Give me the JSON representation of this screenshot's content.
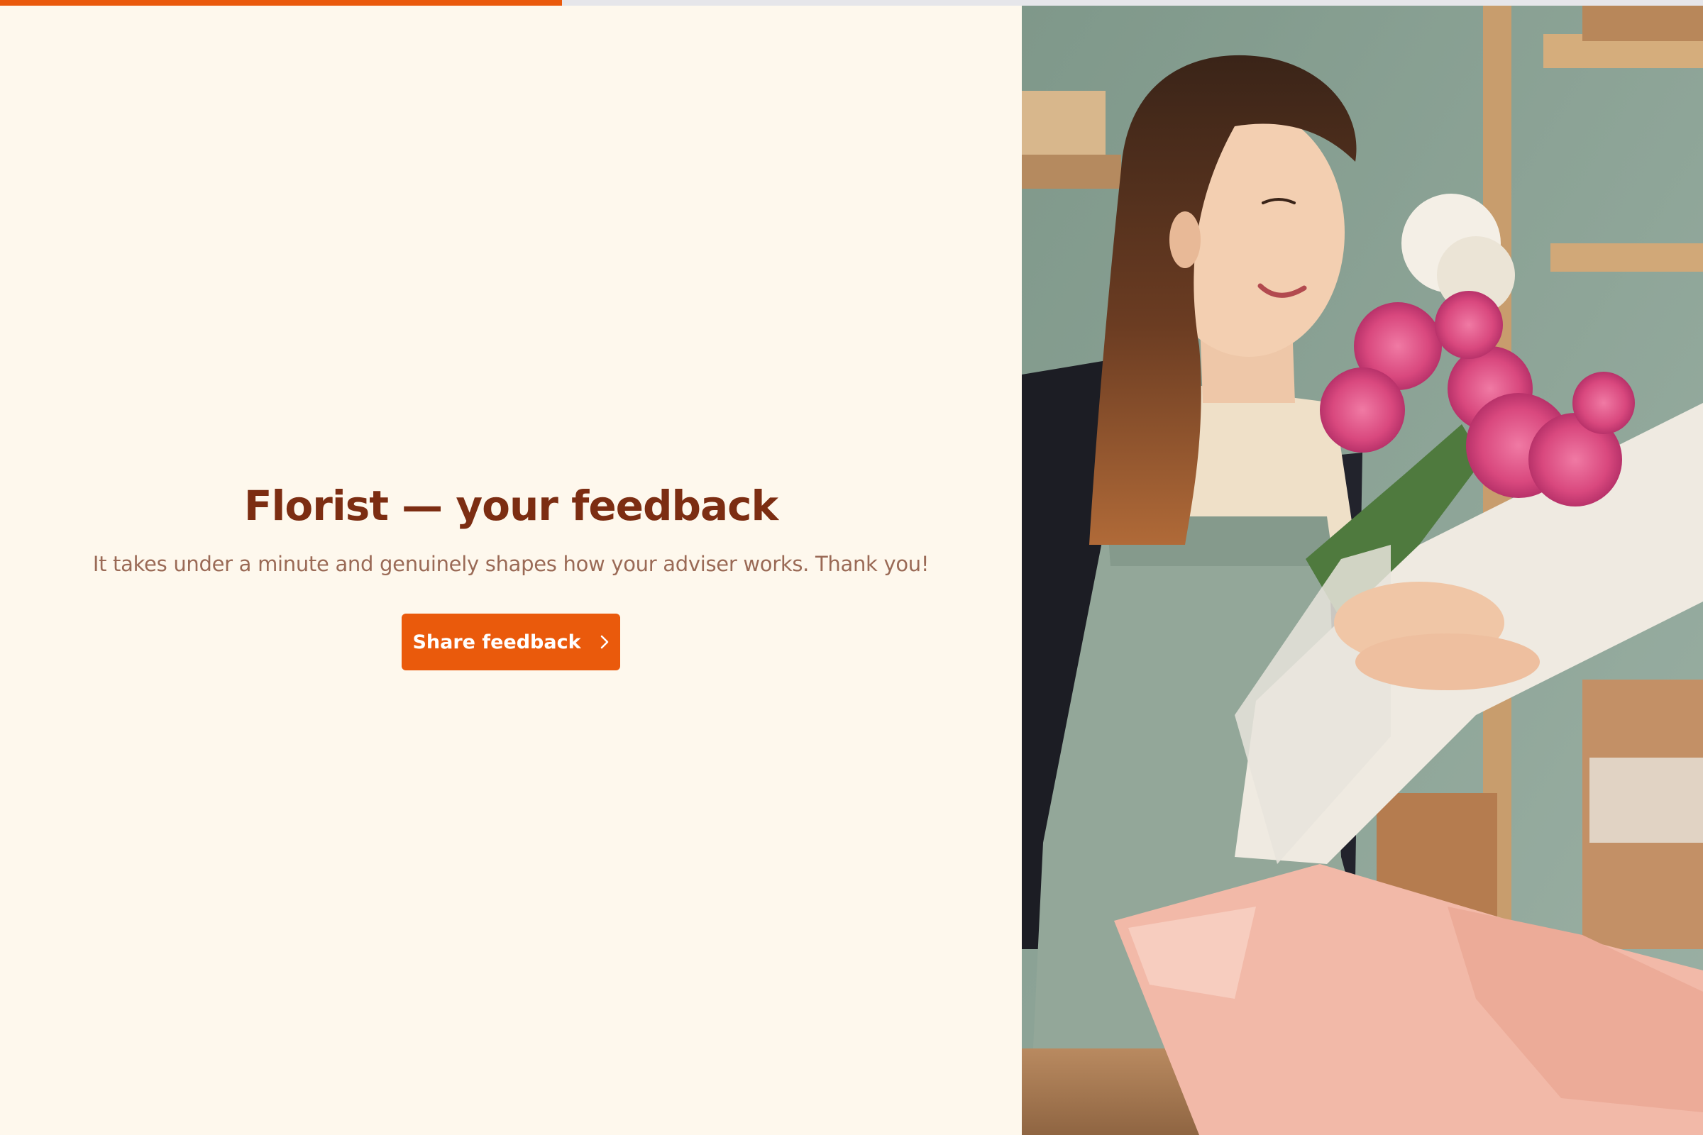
{
  "progress": {
    "fraction": 0.33,
    "fill_color": "#ea5a0c"
  },
  "intro": {
    "title": "Florist — your feedback",
    "subtitle": "It takes under a minute and genuinely shapes how your adviser works. Thank you!",
    "cta_label": "Share feedback",
    "cta_icon": "chevron-right-icon"
  },
  "colors": {
    "background": "#fef8ed",
    "title": "#7c2d12",
    "subtitle": "#9a6a56",
    "accent": "#ea5a0c"
  }
}
